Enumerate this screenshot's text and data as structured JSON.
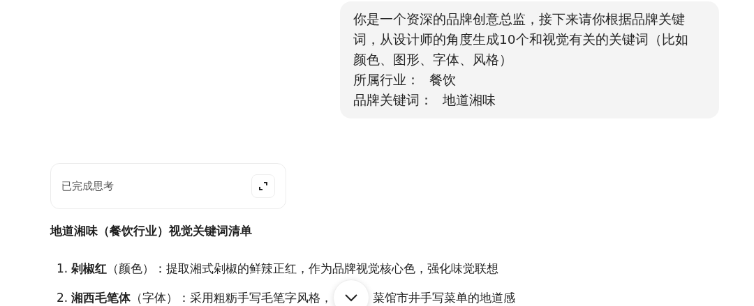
{
  "user_message": {
    "text": "你是一个资深的品牌创意总监，接下来请你根据品牌关键词，从设计师的角度生成10个和视觉有关的关键词（比如颜色、图形、字体、风格）",
    "fields": [
      {
        "label": "所属行业：",
        "value": "餐饮"
      },
      {
        "label": "品牌关键词：",
        "value": "地道湘味"
      }
    ]
  },
  "thinking": {
    "label": "已完成思考"
  },
  "answer": {
    "heading": "地道湘味（餐饮行业）视觉关键词清单",
    "items": [
      {
        "number": "1.",
        "term": "剁椒红",
        "category": "（颜色）：",
        "description": "提取湘式剁椒的鲜辣正红，作为品牌视觉核心色，强化味觉联想"
      },
      {
        "number": "2.",
        "term": "湘西毛笔体",
        "category": "（字体）：",
        "description": "采用粗粝手写毛笔字风格，",
        "description_after": "菜馆市井手写菜单的地道感"
      }
    ]
  }
}
